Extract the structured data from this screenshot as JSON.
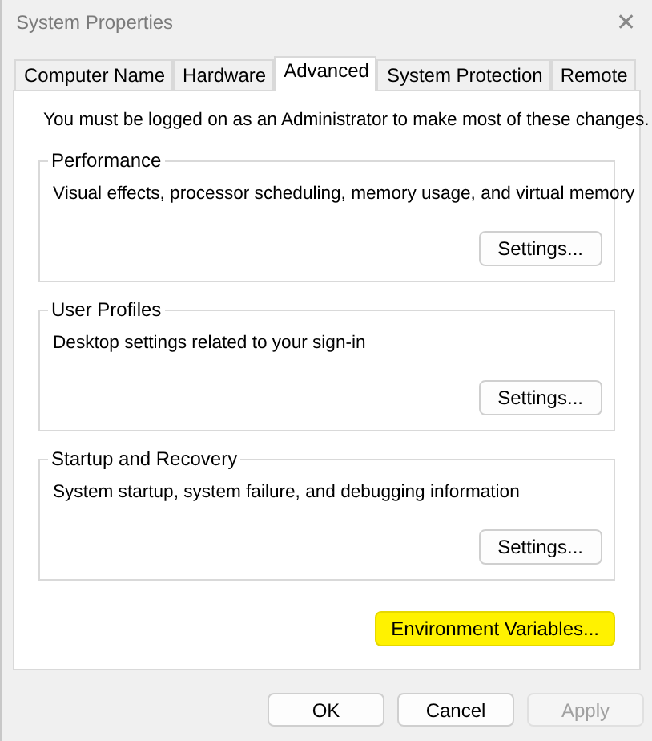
{
  "window": {
    "title": "System Properties",
    "close": "✕"
  },
  "tabs": [
    {
      "label": "Computer Name",
      "selected": false
    },
    {
      "label": "Hardware",
      "selected": false
    },
    {
      "label": "Advanced",
      "selected": true
    },
    {
      "label": "System Protection",
      "selected": false
    },
    {
      "label": "Remote",
      "selected": false
    }
  ],
  "notice": "You must be logged on as an Administrator to make most of these changes.",
  "groups": [
    {
      "title": "Performance",
      "description": "Visual effects, processor scheduling, memory usage, and virtual memory",
      "button": "Settings..."
    },
    {
      "title": "User Profiles",
      "description": "Desktop settings related to your sign-in",
      "button": "Settings..."
    },
    {
      "title": "Startup and Recovery",
      "description": "System startup, system failure, and debugging information",
      "button": "Settings..."
    }
  ],
  "extra_button": {
    "label": "Environment Variables...",
    "highlighted": true
  },
  "buttons": [
    {
      "label": "OK",
      "disabled": false
    },
    {
      "label": "Cancel",
      "disabled": false
    },
    {
      "label": "Apply",
      "disabled": true
    }
  ]
}
